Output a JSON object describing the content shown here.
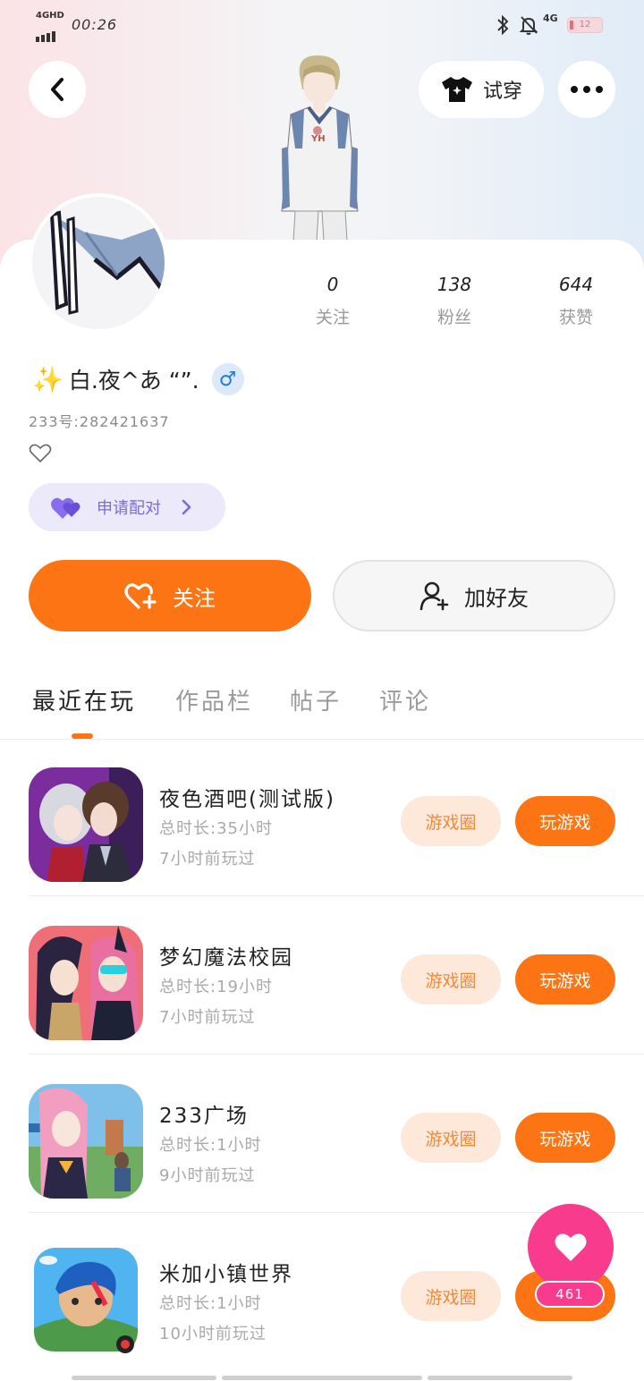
{
  "status_bar": {
    "network": "4GHD",
    "time": "00:26",
    "cell_label": "4G",
    "battery": "12"
  },
  "header": {
    "try_on_label": "试穿"
  },
  "profile": {
    "stats": [
      {
        "value": "0",
        "label": "关注"
      },
      {
        "value": "138",
        "label": "粉丝"
      },
      {
        "value": "644",
        "label": "获赞"
      }
    ],
    "name": "白.夜^あ “”.",
    "name_emoji": "✨",
    "gender_symbol": "♂",
    "uid": "233号:282421637",
    "pair_label": "申请配对"
  },
  "actions": {
    "follow_label": "关注",
    "add_friend_label": "加好友"
  },
  "tabs": [
    "最近在玩",
    "作品栏",
    "帖子",
    "评论"
  ],
  "games": [
    {
      "title": "夜色酒吧(测试版)",
      "total": "总时长:35小时",
      "last": "7小时前玩过",
      "circle_label": "游戏圈",
      "play_label": "玩游戏"
    },
    {
      "title": "梦幻魔法校园",
      "total": "总时长:19小时",
      "last": "7小时前玩过",
      "circle_label": "游戏圈",
      "play_label": "玩游戏"
    },
    {
      "title": "233广场",
      "total": "总时长:1小时",
      "last": "9小时前玩过",
      "circle_label": "游戏圈",
      "play_label": "玩游戏"
    },
    {
      "title": "米加小镇世界",
      "total": "总时长:1小时",
      "last": "10小时前玩过",
      "circle_label": "游戏圈",
      "play_label": "玩游戏"
    }
  ],
  "floating": {
    "like_count": "461"
  },
  "colors": {
    "accent": "#fd7414",
    "pink": "#f83b8c",
    "purple": "#7a6cd6"
  }
}
